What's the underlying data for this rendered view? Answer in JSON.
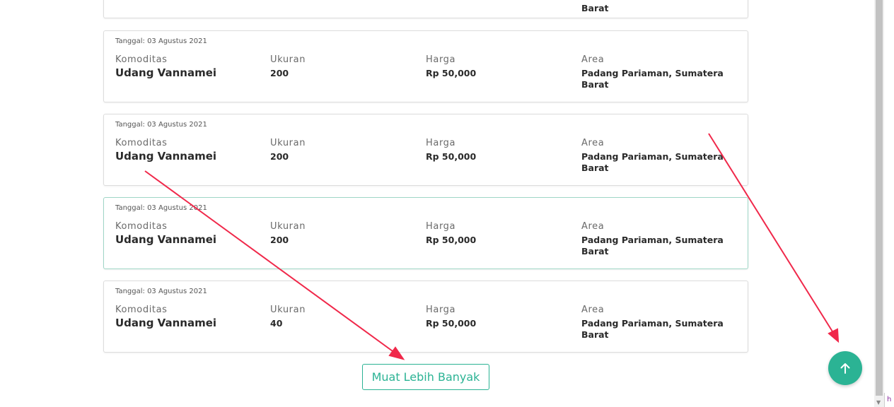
{
  "partial_card": {
    "area_value_tail": "Barat"
  },
  "cards": [
    {
      "date": "Tanggal: 03 Agustus 2021",
      "komoditas_label": "Komoditas",
      "komoditas": "Udang Vannamei",
      "ukuran_label": "Ukuran",
      "ukuran": "200",
      "harga_label": "Harga",
      "harga": "Rp 50,000",
      "area_label": "Area",
      "area": "Padang Pariaman, Sumatera Barat"
    },
    {
      "date": "Tanggal: 03 Agustus 2021",
      "komoditas_label": "Komoditas",
      "komoditas": "Udang Vannamei",
      "ukuran_label": "Ukuran",
      "ukuran": "200",
      "harga_label": "Harga",
      "harga": "Rp 50,000",
      "area_label": "Area",
      "area": "Padang Pariaman, Sumatera Barat"
    },
    {
      "date": "Tanggal: 03 Agustus 2021",
      "komoditas_label": "Komoditas",
      "komoditas": "Udang Vannamei",
      "ukuran_label": "Ukuran",
      "ukuran": "200",
      "harga_label": "Harga",
      "harga": "Rp 50,000",
      "area_label": "Area",
      "area": "Padang Pariaman, Sumatera Barat"
    },
    {
      "date": "Tanggal: 03 Agustus 2021",
      "komoditas_label": "Komoditas",
      "komoditas": "Udang Vannamei",
      "ukuran_label": "Ukuran",
      "ukuran": "40",
      "harga_label": "Harga",
      "harga": "Rp 50,000",
      "area_label": "Area",
      "area": "Padang Pariaman, Sumatera Barat"
    }
  ],
  "load_more_label": "Muat Lebih Banyak",
  "scroll_top_icon": "arrow-up-icon",
  "status_edge_text": "h",
  "colors": {
    "accent": "#2bb394",
    "annotation_arrow": "#f0284a"
  }
}
